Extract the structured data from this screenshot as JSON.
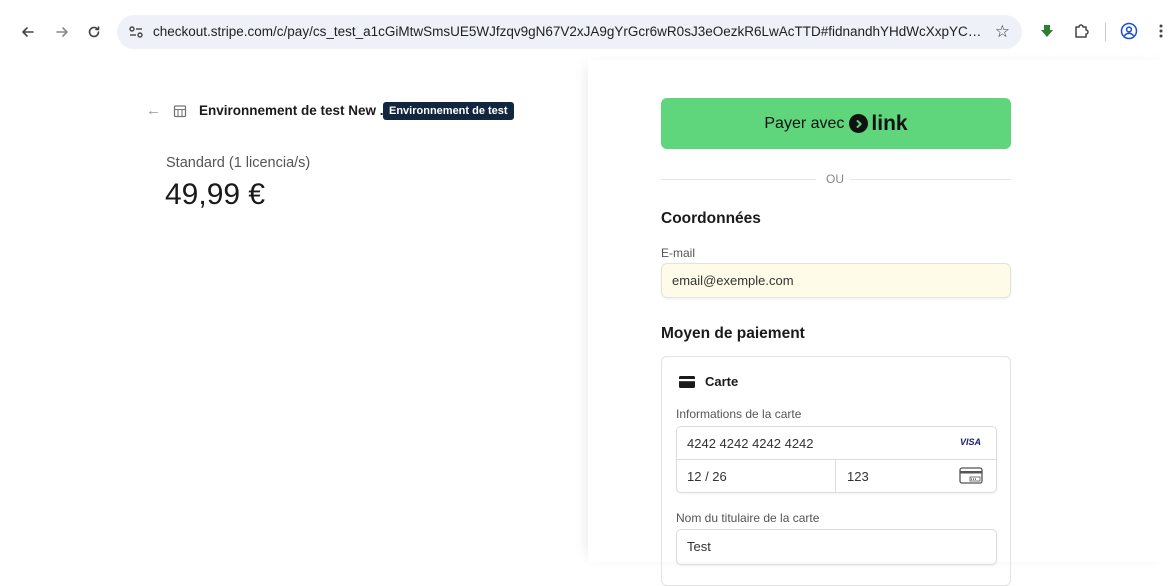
{
  "browser": {
    "url": "checkout.stripe.com/c/pay/cs_test_a1cGiMtwSmsUE5WJfzqv9gN67V2xJA9gYrGcr6wR0sJ3eOezkR6LwAcTTD#fidnandhYHdWcXxpYCc%2FJ2FgY2R..."
  },
  "summary": {
    "merchant": "Environnement de test New ...",
    "badge": "Environnement de test",
    "product": "Standard (1 licencia/s)",
    "price": "49,99 €"
  },
  "payment": {
    "link_button_prefix": "Payer avec",
    "link_brand": "link",
    "or_divider": "OU",
    "contact_title": "Coordonnées",
    "email_label": "E-mail",
    "email_value": "email@exemple.com",
    "method_title": "Moyen de paiement",
    "card_method_label": "Carte",
    "card_info_label": "Informations de la carte",
    "card_number": "4242 4242 4242 4242",
    "card_brand": "VISA",
    "card_expiry": "12 / 26",
    "card_cvc": "123",
    "holder_label": "Nom du titulaire de la carte",
    "holder_value": "Test"
  },
  "colors": {
    "link_green": "#5fd57c",
    "badge_navy": "#12263f",
    "autofill_yellow": "#fefce8"
  }
}
